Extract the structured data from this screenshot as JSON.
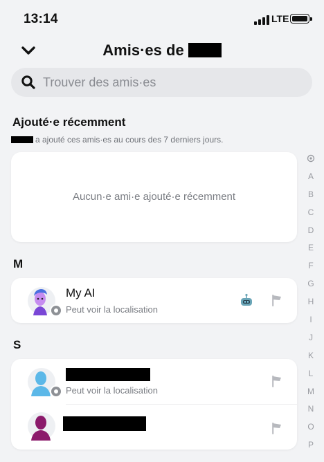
{
  "status_bar": {
    "time": "13:14",
    "network": "LTE"
  },
  "header": {
    "title": "Amis·es de"
  },
  "search": {
    "placeholder": "Trouver des amis·es"
  },
  "recent": {
    "title": "Ajouté·e récemment",
    "subtitle": "a ajouté ces amis·es au cours des 7 derniers jours.",
    "empty_text": "Aucun·e ami·e ajouté·e récemment"
  },
  "sections": {
    "m": {
      "letter": "M",
      "friends": [
        {
          "name": "My AI",
          "status": "Peut voir la localisation"
        }
      ]
    },
    "s": {
      "letter": "S",
      "friends": [
        {
          "status": "Peut voir la localisation"
        }
      ]
    }
  },
  "alpha_index": [
    "A",
    "B",
    "C",
    "D",
    "E",
    "F",
    "G",
    "H",
    "I",
    "J",
    "K",
    "L",
    "M",
    "N",
    "O",
    "P"
  ],
  "colors": {
    "background": "#f2f3f5",
    "card": "#ffffff",
    "muted_text": "#7a7d83",
    "avatar_blue": "#5cb8e8",
    "avatar_purple": "#8b1a6b"
  },
  "icons": [
    "back-chevron-icon",
    "search-icon",
    "flag-icon",
    "robot-icon",
    "location-badge-icon",
    "friend-avatar-icon"
  ]
}
